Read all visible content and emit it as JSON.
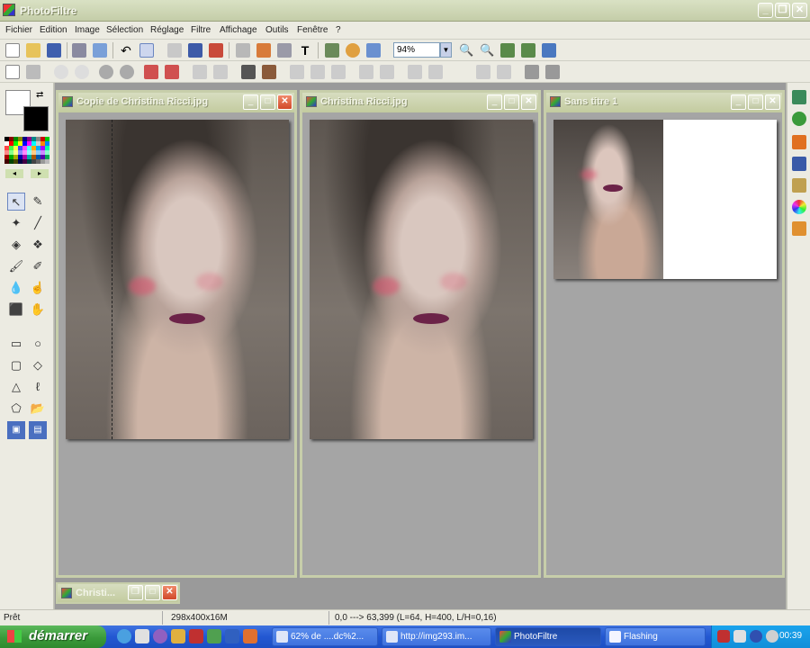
{
  "window": {
    "title": "PhotoFiltre"
  },
  "menu": [
    "Fichier",
    "Edition",
    "Image",
    "Sélection",
    "Réglage",
    "Filtre",
    "Affichage",
    "Outils",
    "Fenêtre",
    "?"
  ],
  "toolbar": {
    "zoom_value": "94%"
  },
  "documents": [
    {
      "name": "Copie de Christina Ricci.jpg"
    },
    {
      "name": "Christina Ricci.jpg"
    },
    {
      "name": "Sans titre 1"
    }
  ],
  "minimized_doc": {
    "name": "Christi..."
  },
  "status": {
    "ready": "Prêt",
    "dimensions": "298x400x16M",
    "selection": "0,0 ---> 63,399 (L=64, H=400, L/H=0,16)"
  },
  "taskbar": {
    "start_label": "démarrer",
    "tasks": [
      {
        "label": "62% de ....dc%2..."
      },
      {
        "label": "http://img293.im..."
      },
      {
        "label": "PhotoFiltre"
      },
      {
        "label": "Flashing"
      }
    ],
    "clock": "00:39"
  },
  "colors": {
    "foreground": "#ffffff",
    "background": "#000000"
  }
}
